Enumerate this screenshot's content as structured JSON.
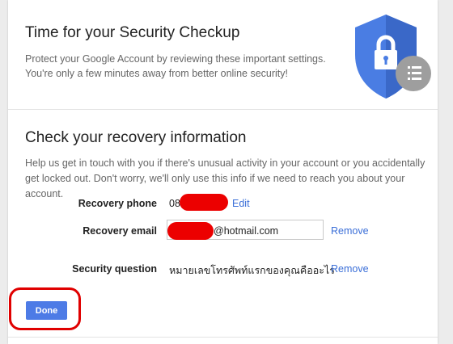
{
  "hero": {
    "title": "Time for your Security Checkup",
    "description": "Protect your Google Account by reviewing these important settings. You're only a few minutes away from better online security!"
  },
  "recovery": {
    "title": "Check your recovery information",
    "description": "Help us get in touch with you if there's unusual activity in your account or you accidentally get locked out. Don't worry, we'll only use this info if we need to reach you about your account.",
    "phone": {
      "label": "Recovery phone",
      "value_prefix": "08",
      "edit_label": "Edit"
    },
    "email": {
      "label": "Recovery email",
      "value_suffix": "@hotmail.com",
      "remove_label": "Remove"
    },
    "question": {
      "label": "Security question",
      "value": "หมายเลขโทรศัพท์แรกของคุณคืออะไร",
      "remove_label": "Remove"
    }
  },
  "actions": {
    "done_label": "Done"
  },
  "colors": {
    "accent": "#4d7be6",
    "link": "#3b6fd8",
    "redaction": "#ec0000",
    "shield_blue": "#4a7de3",
    "badge_gray": "#9e9e9e"
  },
  "icons": {
    "shield": "shield-lock-icon",
    "list_badge": "list-icon"
  }
}
